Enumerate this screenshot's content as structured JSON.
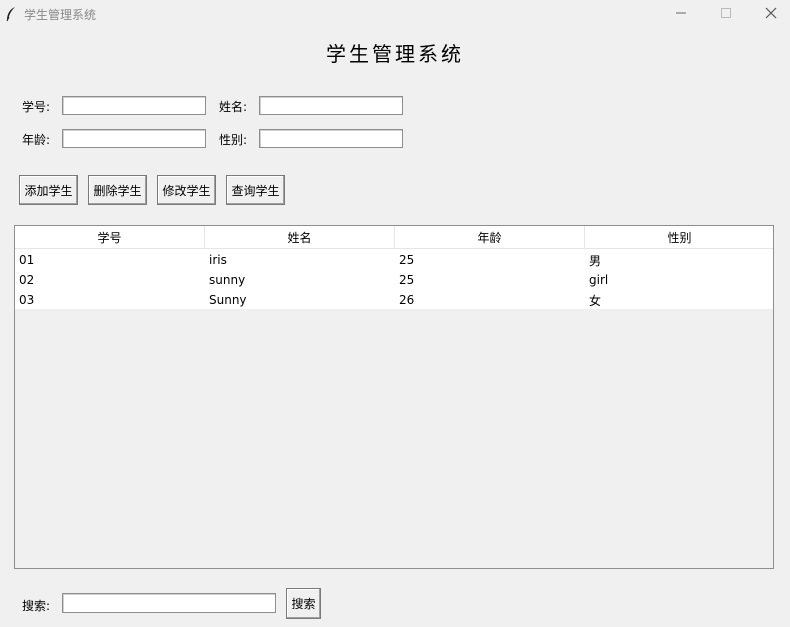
{
  "window": {
    "title": "学生管理系统"
  },
  "app": {
    "heading": "学生管理系统"
  },
  "form": {
    "id_label": "学号:",
    "id_value": "",
    "name_label": "姓名:",
    "name_value": "",
    "age_label": "年龄:",
    "age_value": "",
    "gender_label": "性别:",
    "gender_value": ""
  },
  "actions": {
    "add": "添加学生",
    "delete": "删除学生",
    "modify": "修改学生",
    "query": "查询学生"
  },
  "table": {
    "columns": [
      "学号",
      "姓名",
      "年龄",
      "性别"
    ],
    "rows": [
      [
        "01",
        "iris",
        "25",
        "男"
      ],
      [
        "02",
        "sunny",
        "25",
        "girl"
      ],
      [
        "03",
        "Sunny",
        "26",
        "女"
      ]
    ]
  },
  "search": {
    "label": "搜索:",
    "value": "",
    "button": "搜索"
  },
  "icons": {
    "app": "feather-icon",
    "minimize": "minimize-icon",
    "maximize": "maximize-icon",
    "close": "close-icon"
  }
}
